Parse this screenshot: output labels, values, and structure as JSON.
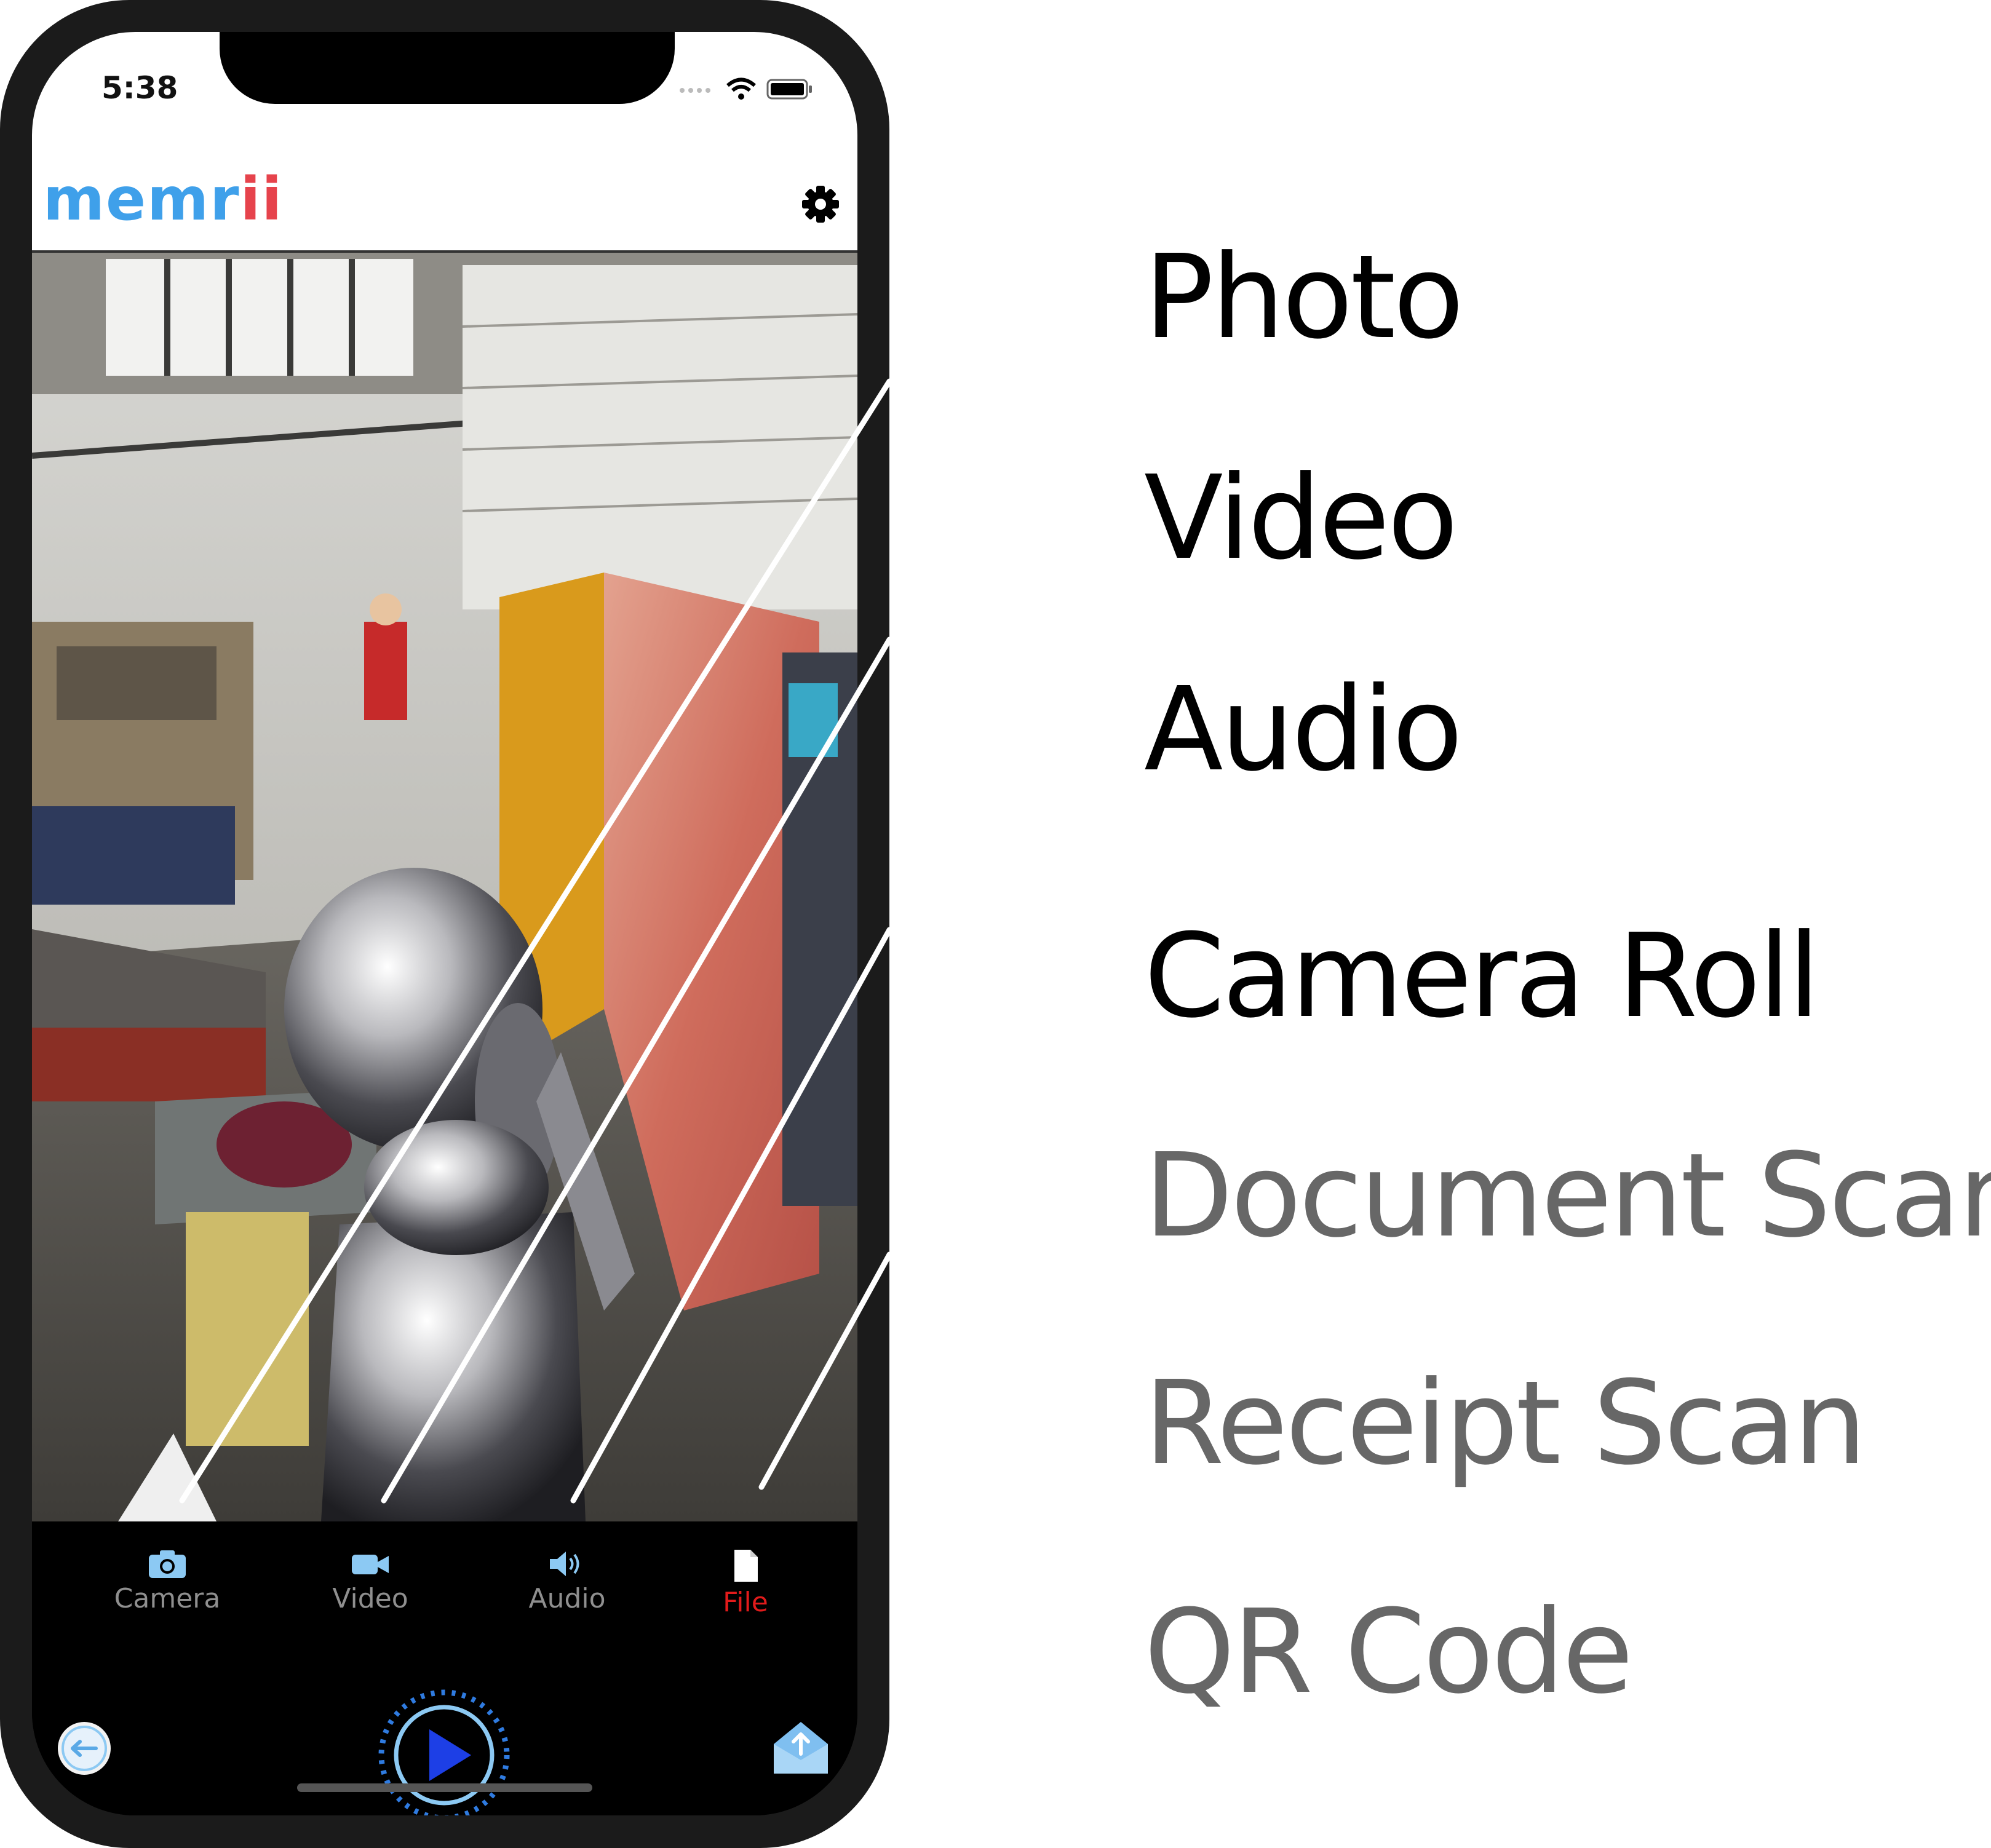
{
  "status_bar": {
    "time": "5:38"
  },
  "app": {
    "logo_main": "memr",
    "logo_accent": "ii"
  },
  "tabs": [
    {
      "label": "Camera",
      "icon": "camera-icon",
      "active": false
    },
    {
      "label": "Video",
      "icon": "video-icon",
      "active": false
    },
    {
      "label": "Audio",
      "icon": "speaker-icon",
      "active": false
    },
    {
      "label": "File",
      "icon": "file-icon",
      "active": true
    }
  ],
  "colors": {
    "brand_blue": "#3fa0ea",
    "brand_red": "#e6434c",
    "tab_active": "#e21b1b",
    "tab_inactive": "#8f8f8f",
    "play_button": "#1d3fe6",
    "feature_available": "#000000",
    "feature_unavailable": "#676767"
  },
  "features": [
    {
      "label": "Photo",
      "available": true
    },
    {
      "label": "Video",
      "available": true
    },
    {
      "label": "Audio",
      "available": true
    },
    {
      "label": "Camera Roll",
      "available": true
    },
    {
      "label": "Document Scan",
      "available": false
    },
    {
      "label": "Receipt Scan",
      "available": false
    },
    {
      "label": "QR Code",
      "available": false
    }
  ]
}
